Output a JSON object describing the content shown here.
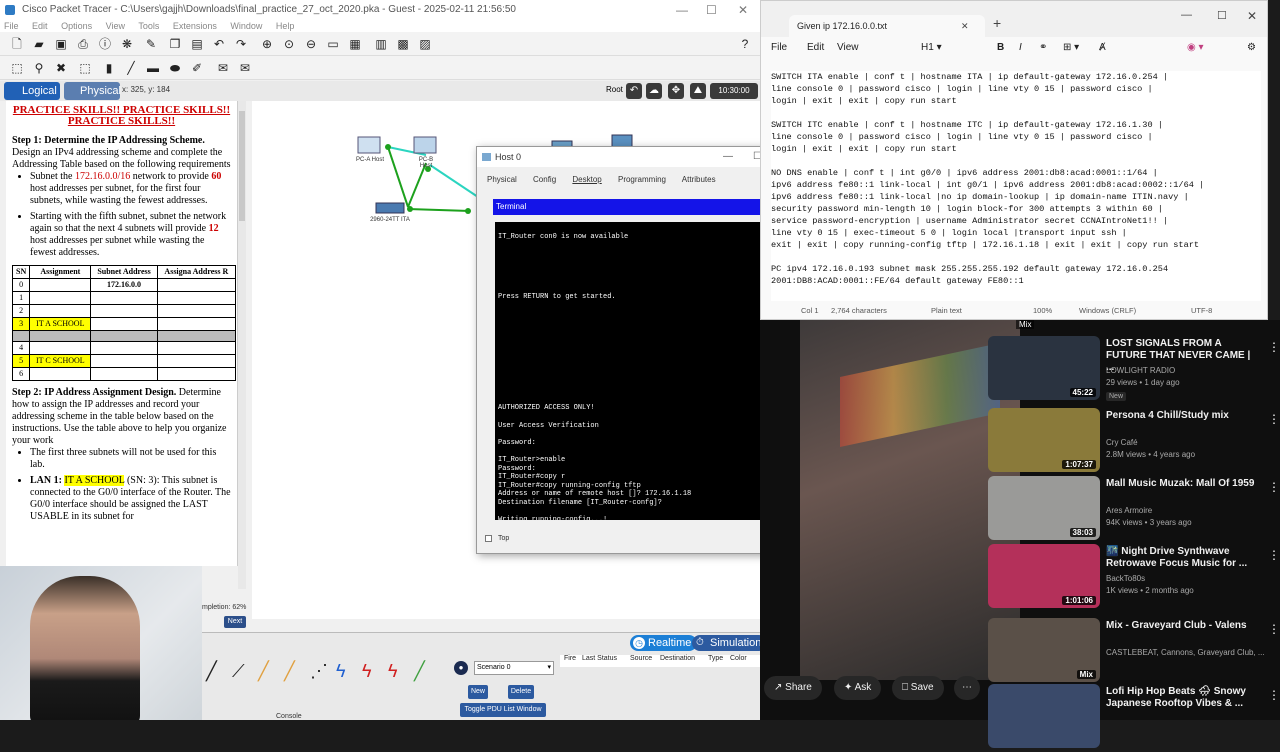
{
  "packet_tracer": {
    "title": "Cisco Packet Tracer - C:\\Users\\gajjh\\Downloads\\final_practice_27_oct_2020.pka - Guest - 2025-02-11 21:56:50",
    "menu": [
      "File",
      "Edit",
      "Options",
      "View",
      "Tools",
      "Extensions",
      "Window",
      "Help"
    ],
    "tab_logical": "Logical",
    "tab_physical": "Physical",
    "coords": "x: 325, y: 184",
    "root_label": "Root",
    "clock": "10:30:00",
    "doc": {
      "heading": "PRACTICE SKILLS!! PRACTICE SKILLS!! PRACTICE SKILLS!!",
      "step1_title": "Step 1: Determine the IP Addressing Scheme.",
      "step1_text": "Design an IPv4 addressing scheme and complete the Addressing Table based on the following requirements",
      "bullet1_pre": "Subnet the",
      "bullet1_net": "172.16.0.0/16",
      "bullet1_mid": "network to provide",
      "bullet1_num": "60",
      "bullet1_post": "host addresses per subnet, for the first four subnets, while wasting the fewest addresses.",
      "bullet2_pre": "Starting with the fifth subnet, subnet the network again so that the next 4 subnets will provide",
      "bullet2_num": "12",
      "bullet2_post": "host addresses per subnet while wasting the fewest addresses.",
      "table_headers": [
        "SN",
        "Assignment",
        "Subnet Address",
        "Assigna Address R"
      ],
      "table_rows": [
        [
          "0",
          "",
          "172.16.0.0",
          ""
        ],
        [
          "1",
          "",
          "",
          ""
        ],
        [
          "2",
          "",
          "",
          ""
        ],
        [
          "3",
          "IT A SCHOOL",
          "",
          ""
        ],
        [
          "",
          "",
          "",
          ""
        ],
        [
          "4",
          "",
          "",
          ""
        ],
        [
          "5",
          "IT C SCHOOL",
          "",
          ""
        ],
        [
          "6",
          "",
          "",
          ""
        ]
      ],
      "step2_title": "Step 2: IP Address Assignment Design.",
      "step2_text": "Determine how to assign the IP addresses and record your addressing scheme in the table below based on the instructions. Use the table above to help you organize your work",
      "bullet3": "The first three subnets will not be used for this lab.",
      "lan1_label": "LAN 1:",
      "lan1_name": "IT A SCHOOL",
      "lan1_rest": "(SN: 3): This subnet is connected to the G0/0 interface of the Router. The G0/0 interface should be assigned the LAST USABLE in its subnet for",
      "completion": "mpletion: 62%",
      "next": "Next"
    },
    "devices": {
      "pc_a": "PC-A Host",
      "pc_b": "PC-B Host",
      "switch": "2960-24TT ITA"
    },
    "bottom": {
      "realtime": "Realtime",
      "simulation": "Simulation",
      "scenario": "Scenario 0",
      "new": "New",
      "delete": "Delete",
      "toggle": "Toggle PDU List Window",
      "pdu_headers": [
        "Fire",
        "Last Status",
        "Source",
        "Destination",
        "Type",
        "Color"
      ],
      "console": "Console"
    }
  },
  "host": {
    "title": "Host 0",
    "tabs": [
      "Physical",
      "Config",
      "Desktop",
      "Programming",
      "Attributes"
    ],
    "terminal_title": "Terminal",
    "terminal_lines": [
      "",
      "IT_Router con0 is now available",
      "",
      "",
      "",
      "",
      "",
      "",
      "Press RETURN to get started.",
      "",
      "",
      "",
      "",
      "",
      "",
      "",
      "",
      "",
      "",
      "",
      "",
      "AUTHORIZED ACCESS ONLY!",
      "",
      "User Access Verification",
      "",
      "Password:",
      "",
      "IT_Router>enable",
      "Password:",
      "IT_Router#copy r",
      "IT_Router#copy running-config tftp",
      "Address or name of remote host []? 172.16.1.18",
      "Destination filename [IT_Router-confg]?",
      "",
      "Writing running-config...!"
    ],
    "top_label": "Top"
  },
  "notepad": {
    "tab_title": "Given ip 172.16.0.0.txt",
    "menu": [
      "File",
      "Edit",
      "View"
    ],
    "heading": "H1",
    "lines": [
      "SWITCH ITA enable | conf t | hostname ITA | ip default-gateway 172.16.0.254 |",
      "line console 0 | password cisco | login | line vty 0 15 | password cisco |",
      "login | exit | exit | copy run start",
      "",
      "SWITCH ITC enable | conf t | hostname ITC | ip default-gateway 172.16.1.30 |",
      "line console 0 | password cisco | login | line vty 0 15 | password cisco |",
      "login | exit | exit | copy run start",
      "",
      "NO DNS enable | conf t | int g0/0 | ipv6 address 2001:db8:acad:0001::1/64 |",
      "ipv6 address fe80::1 link-local | int g0/1 | ipv6 address 2001:db8:acad:0002::1/64 |",
      "ipv6 address fe80::1 link-local |no ip domain-lookup | ip domain-name ITIN.navy |",
      "security password min-length 10 | login block-for 300 attempts 3 within 60 |",
      "service password-encryption | username Administrator secret CCNAIntroNet1!! |",
      "line vty 0 15 | exec-timeout 5 0 | login local |transport input ssh |",
      "exit | exit | copy running-config tftp | 172.16.1.18 | exit | exit | copy run start",
      "",
      "PC ipv4 172.16.0.193 subnet mask 255.255.255.192 default gateway 172.16.0.254",
      "2001:DB8:ACAD:0001::FE/64 default gateway FE80::1"
    ],
    "status": {
      "position": "Col 1",
      "characters": "2,764 characters",
      "format": "Plain text",
      "zoom": "100%",
      "line_ending": "Windows (CRLF)",
      "encoding": "UTF-8"
    }
  },
  "youtube": {
    "items": [
      {
        "title": "LOST SIGNALS FROM A FUTURE THAT NEVER CAME | ...",
        "channel": "LOWLIGHT RADIO",
        "meta": "29 views • 1 day ago",
        "badge": "New",
        "duration": "45:22",
        "mix": "",
        "thumb": "#2a3340"
      },
      {
        "title": "Persona 4 Chill/Study mix",
        "channel": "Cry Café",
        "meta": "2.8M views • 4 years ago",
        "badge": "",
        "duration": "1:07:37",
        "mix": "",
        "thumb": "#8a7a3a"
      },
      {
        "title": "Mall Music Muzak: Mall Of 1959",
        "channel": "Ares Armoire",
        "meta": "94K views • 3 years ago",
        "badge": "",
        "duration": "38:03",
        "mix": "",
        "thumb": "#9a9a98"
      },
      {
        "title": "🌃 Night Drive Synthwave Retrowave Focus Music for ...",
        "channel": "BackTo80s",
        "meta": "1K views • 2 months ago",
        "badge": "",
        "duration": "1:01:06",
        "mix": "",
        "thumb": "#b4305a"
      },
      {
        "title": "Mix - Graveyard Club - Valens",
        "channel": "CASTLEBEAT, Cannons, Graveyard Club, ...",
        "meta": "",
        "badge": "",
        "duration": "",
        "mix": "Mix",
        "thumb": "#5a5048"
      },
      {
        "title": "Lofi Hip Hop Beats 🌧 Snowy Japanese Rooftop Vibes & ...",
        "channel": "",
        "meta": "",
        "badge": "",
        "duration": "",
        "mix": "",
        "thumb": "#3a4a6a"
      }
    ],
    "share": "Share",
    "ask": "Ask",
    "save": "Save",
    "mix_top": "Mix"
  }
}
